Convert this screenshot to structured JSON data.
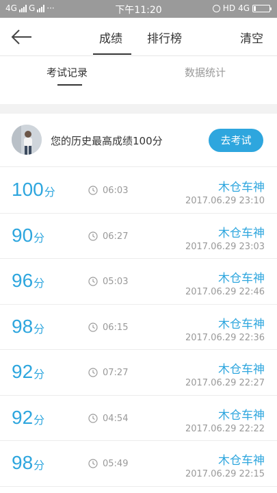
{
  "status_bar": {
    "net1": "4G",
    "net2": "G",
    "dots": "···",
    "time": "下午11:20",
    "hd": "HD",
    "net3": "4G"
  },
  "nav": {
    "tab_score": "成绩",
    "tab_rank": "排行榜",
    "clear": "清空"
  },
  "subtabs": {
    "records": "考试记录",
    "stats": "数据统计"
  },
  "best": {
    "text": "您的历史最高成绩100分",
    "button": "去考试"
  },
  "unit": "分",
  "records": [
    {
      "score": "100",
      "duration": "06:03",
      "name": "木仓车神",
      "datetime": "2017.06.29   23:10"
    },
    {
      "score": "90",
      "duration": "06:27",
      "name": "木仓车神",
      "datetime": "2017.06.29   23:03"
    },
    {
      "score": "96",
      "duration": "05:03",
      "name": "木仓车神",
      "datetime": "2017.06.29   22:46"
    },
    {
      "score": "98",
      "duration": "06:15",
      "name": "木仓车神",
      "datetime": "2017.06.29   22:36"
    },
    {
      "score": "92",
      "duration": "07:27",
      "name": "木仓车神",
      "datetime": "2017.06.29   22:27"
    },
    {
      "score": "92",
      "duration": "04:54",
      "name": "木仓车神",
      "datetime": "2017.06.29   22:22"
    },
    {
      "score": "98",
      "duration": "05:49",
      "name": "木仓车神",
      "datetime": "2017.06.29   22:15"
    }
  ],
  "accent_color": "#2ea6de"
}
